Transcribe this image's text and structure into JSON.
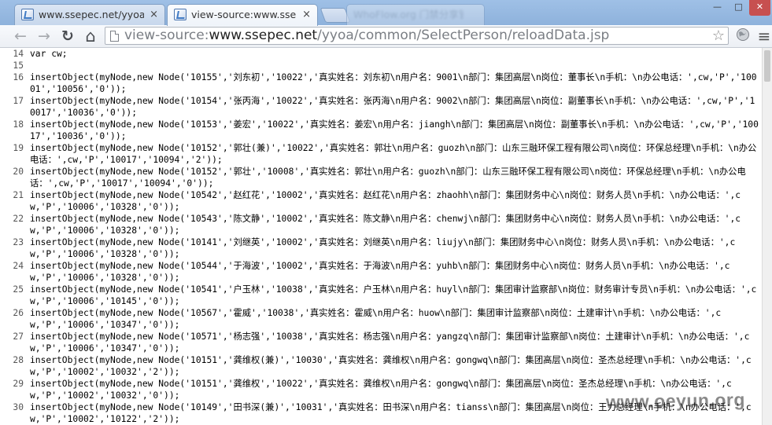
{
  "tabs": [
    {
      "title": "www.ssepec.net/yyoa/c",
      "close": "×"
    },
    {
      "title": "view-source:www.ssepe",
      "close": "×"
    },
    {
      "title": "WhoFlow.org 门禁分享管理"
    }
  ],
  "window_controls": {
    "minimize": "—",
    "maximize": "□",
    "close": "✕"
  },
  "toolbar": {
    "back_glyph": "←",
    "forward_glyph": "→",
    "reload_glyph": "↻",
    "home_glyph": "⌂",
    "url_prefix": "view-source:",
    "url_host": "www.ssepec.net",
    "url_path": "/yyoa/common/SelectPerson/reloadData.jsp",
    "bookmark_glyph": "☆",
    "menu_glyph": "≡"
  },
  "icons": {
    "tab_favicon": "page-icon",
    "extension": "globe-icon",
    "menu": "hamburger-icon"
  },
  "source_lines": [
    {
      "num": "14",
      "code": "var cw;"
    },
    {
      "num": "15",
      "code": ""
    },
    {
      "num": "16",
      "code": "insertObject(myNode,new Node('10155','刘东初','10022','真实姓名：刘东初\\n用户名：9001\\n部门：集团高层\\n岗位：董事长\\n手机：\\n办公电话：',cw,'P','10001','10056','0'));"
    },
    {
      "num": "17",
      "code": "insertObject(myNode,new Node('10154','张丙海','10022','真实姓名：张丙海\\n用户名：9002\\n部门：集团高层\\n岗位：副董事长\\n手机：\\n办公电话：',cw,'P','10017','10036','0'));"
    },
    {
      "num": "18",
      "code": "insertObject(myNode,new Node('10153','姜宏','10022','真实姓名：姜宏\\n用户名：jiangh\\n部门：集团高层\\n岗位：副董事长\\n手机：\\n办公电话：',cw,'P','10017','10036','0'));"
    },
    {
      "num": "19",
      "code": "insertObject(myNode,new Node('10152','郭壮(兼)','10022','真实姓名：郭壮\\n用户名：guozh\\n部门：山东三融环保工程有限公司\\n岗位：环保总经理\\n手机：\\n办公电话：',cw,'P','10017','10094','2'));"
    },
    {
      "num": "20",
      "code": "insertObject(myNode,new Node('10152','郭壮','10008','真实姓名：郭壮\\n用户名：guozh\\n部门：山东三融环保工程有限公司\\n岗位：环保总经理\\n手机：\\n办公电话：',cw,'P','10017','10094','0'));"
    },
    {
      "num": "21",
      "code": "insertObject(myNode,new Node('10542','赵红花','10002','真实姓名：赵红花\\n用户名：zhaohh\\n部门：集团财务中心\\n岗位：财务人员\\n手机：\\n办公电话：',cw,'P','10006','10328','0'));"
    },
    {
      "num": "22",
      "code": "insertObject(myNode,new Node('10543','陈文静','10002','真实姓名：陈文静\\n用户名：chenwj\\n部门：集团财务中心\\n岗位：财务人员\\n手机：\\n办公电话：',cw,'P','10006','10328','0'));"
    },
    {
      "num": "23",
      "code": "insertObject(myNode,new Node('10141','刘继英','10002','真实姓名：刘继英\\n用户名：liujy\\n部门：集团财务中心\\n岗位：财务人员\\n手机：\\n办公电话：',cw,'P','10006','10328','0'));"
    },
    {
      "num": "24",
      "code": "insertObject(myNode,new Node('10544','于海波','10002','真实姓名：于海波\\n用户名：yuhb\\n部门：集团财务中心\\n岗位：财务人员\\n手机：\\n办公电话：',cw,'P','10006','10328','0'));"
    },
    {
      "num": "25",
      "code": "insertObject(myNode,new Node('10541','户玉林','10038','真实姓名：户玉林\\n用户名：huyl\\n部门：集团审计监察部\\n岗位：财务审计专员\\n手机：\\n办公电话：',cw,'P','10006','10145','0'));"
    },
    {
      "num": "26",
      "code": "insertObject(myNode,new Node('10567','霍威','10038','真实姓名：霍威\\n用户名：huow\\n部门：集团审计监察部\\n岗位：土建审计\\n手机：\\n办公电话：',cw,'P','10006','10347','0'));"
    },
    {
      "num": "27",
      "code": "insertObject(myNode,new Node('10571','杨志强','10038','真实姓名：杨志强\\n用户名：yangzq\\n部门：集团审计监察部\\n岗位：土建审计\\n手机：\\n办公电话：',cw,'P','10006','10347','0'));"
    },
    {
      "num": "28",
      "code": "insertObject(myNode,new Node('10151','龚维权(兼)','10030','真实姓名：龚维权\\n用户名：gongwq\\n部门：集团高层\\n岗位：圣杰总经理\\n手机：\\n办公电话：',cw,'P','10002','10032','2'));"
    },
    {
      "num": "29",
      "code": "insertObject(myNode,new Node('10151','龚维权','10022','真实姓名：龚维权\\n用户名：gongwq\\n部门：集团高层\\n岗位：圣杰总经理\\n手机：\\n办公电话：',cw,'P','10002','10032','0'));"
    },
    {
      "num": "30",
      "code": "insertObject(myNode,new Node('10149','田书深(兼)','10031','真实姓名：田书深\\n用户名：tianss\\n部门：集团高层\\n岗位：王力总经理\\n手机：\\n办公电话：',cw,'P','10002','10122','2'));"
    }
  ],
  "watermark": "www.oeyun.org"
}
